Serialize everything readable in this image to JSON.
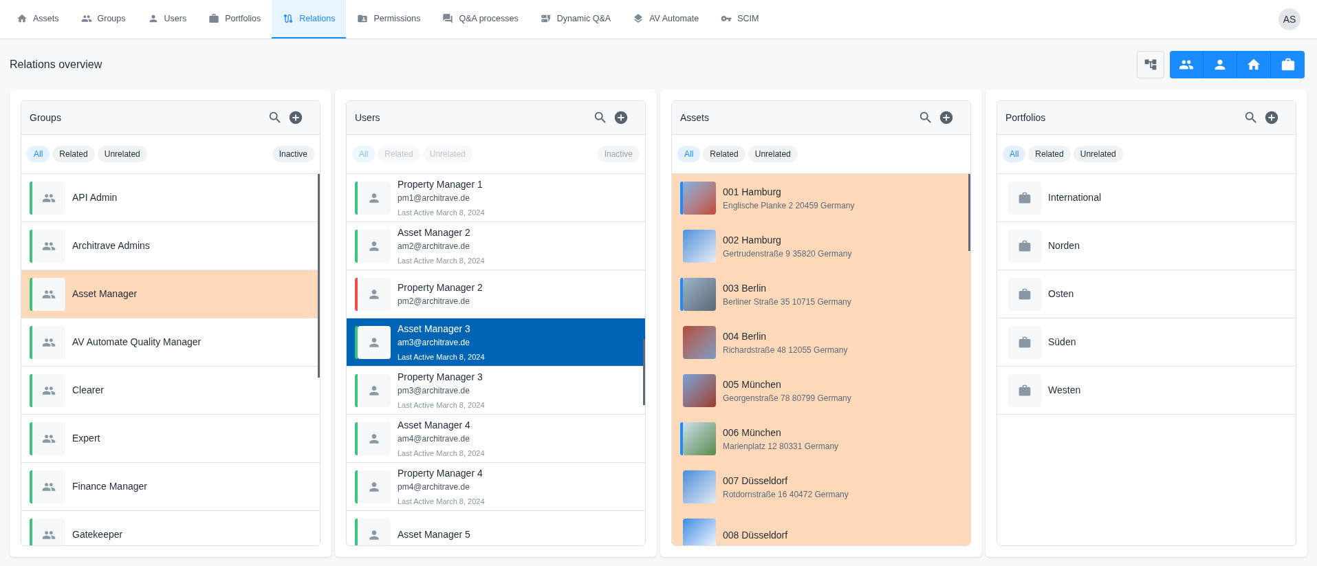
{
  "nav": {
    "tabs": [
      {
        "label": "Assets",
        "selected": false
      },
      {
        "label": "Groups",
        "selected": false
      },
      {
        "label": "Users",
        "selected": false
      },
      {
        "label": "Portfolios",
        "selected": false
      },
      {
        "label": "Relations",
        "selected": true
      },
      {
        "label": "Permissions",
        "selected": false
      },
      {
        "label": "Q&A processes",
        "selected": false
      },
      {
        "label": "Dynamic Q&A",
        "selected": false
      },
      {
        "label": "AV Automate",
        "selected": false
      },
      {
        "label": "SCIM",
        "selected": false
      }
    ],
    "avatar": "AS"
  },
  "page_title": "Relations overview",
  "columns": [
    {
      "kind": "groups",
      "title": "Groups",
      "filters_disabled": false,
      "filters": [
        {
          "label": "All",
          "selected": true
        },
        {
          "label": "Related",
          "selected": false
        },
        {
          "label": "Unrelated",
          "selected": false
        }
      ],
      "inactive": "Inactive",
      "items": [
        {
          "name": "API Admin",
          "color": "#3cc47c",
          "highlighted": false,
          "selected": false
        },
        {
          "name": "Architrave Admins",
          "color": "#3cc47c",
          "highlighted": false,
          "selected": false
        },
        {
          "name": "Asset Manager",
          "color": "#3cc47c",
          "highlighted": true,
          "selected": false
        },
        {
          "name": "AV Automate Quality Manager",
          "color": "#3cc47c",
          "highlighted": false,
          "selected": false
        },
        {
          "name": "Clearer",
          "color": "#3cc47c",
          "highlighted": false,
          "selected": false
        },
        {
          "name": "Expert",
          "color": "#3cc47c",
          "highlighted": false,
          "selected": false
        },
        {
          "name": "Finance Manager",
          "color": "#3cc47c",
          "highlighted": false,
          "selected": false
        },
        {
          "name": "Gatekeeper",
          "color": "#3cc47c",
          "highlighted": false,
          "selected": false
        }
      ]
    },
    {
      "kind": "users",
      "title": "Users",
      "filters_disabled": true,
      "filters": [
        {
          "label": "All",
          "selected": true
        },
        {
          "label": "Related",
          "selected": false
        },
        {
          "label": "Unrelated",
          "selected": false
        }
      ],
      "inactive": "Inactive",
      "items": [
        {
          "name": "Property Manager 1",
          "email": "pm1@architrave.de",
          "last_active": "Last Active March 8, 2024",
          "color": "#3cc47c",
          "selected": false
        },
        {
          "name": "Asset Manager 2",
          "email": "am2@architrave.de",
          "last_active": "Last Active March 8, 2024",
          "color": "#3cc47c",
          "selected": false
        },
        {
          "name": "Property Manager 2",
          "email": "pm2@architrave.de",
          "color": "#f04c4c",
          "selected": false
        },
        {
          "name": "Asset Manager 3",
          "email": "am3@architrave.de",
          "last_active": "Last Active March 8, 2024",
          "color": "#3cc47c",
          "selected": true
        },
        {
          "name": "Property Manager 3",
          "email": "pm3@architrave.de",
          "last_active": "Last Active March 8, 2024",
          "color": "#3cc47c",
          "selected": false
        },
        {
          "name": "Asset Manager 4",
          "email": "am4@architrave.de",
          "last_active": "Last Active March 8, 2024",
          "color": "#3cc47c",
          "selected": false
        },
        {
          "name": "Property Manager 4",
          "email": "pm4@architrave.de",
          "last_active": "Last Active March 8, 2024",
          "color": "#3cc47c",
          "selected": false
        },
        {
          "name": "Asset Manager 5",
          "color": "#3cc47c",
          "selected": false
        }
      ]
    },
    {
      "kind": "assets",
      "title": "Assets",
      "filters_disabled": false,
      "filters": [
        {
          "label": "All",
          "selected": true
        },
        {
          "label": "Related",
          "selected": false
        },
        {
          "label": "Unrelated",
          "selected": false
        }
      ],
      "items": [
        {
          "name": "001 Hamburg",
          "address": "Englische Planke 2 20459 Germany",
          "color": "#1a8cff",
          "highlighted": true,
          "selected": false
        },
        {
          "name": "002 Hamburg",
          "address": "Gertrudenstraße 9 35820 Germany",
          "highlighted": true,
          "selected": false
        },
        {
          "name": "003 Berlin",
          "address": "Berliner Straße 35 10715 Germany",
          "color": "#1a8cff",
          "highlighted": true,
          "selected": false
        },
        {
          "name": "004 Berlin",
          "address": "Richardstraße 48 12055 Germany",
          "highlighted": true,
          "selected": false
        },
        {
          "name": "005 München",
          "address": "Georgenstraße 78 80799 Germany",
          "highlighted": true,
          "selected": false
        },
        {
          "name": "006 München",
          "address": "Marienplatz 12 80331 Germany",
          "color": "#1a8cff",
          "highlighted": true,
          "selected": false
        },
        {
          "name": "007 Düsseldorf",
          "address": "Rotdornstraße 16 40472 Germany",
          "highlighted": true,
          "selected": false
        },
        {
          "name": "008 Düsseldorf",
          "highlighted": true,
          "selected": false
        }
      ]
    },
    {
      "kind": "portfolios",
      "title": "Portfolios",
      "filters_disabled": false,
      "filters": [
        {
          "label": "All",
          "selected": true
        },
        {
          "label": "Related",
          "selected": false
        },
        {
          "label": "Unrelated",
          "selected": false
        }
      ],
      "items": [
        {
          "name": "International",
          "highlighted": false,
          "selected": false
        },
        {
          "name": "Norden",
          "highlighted": false,
          "selected": false
        },
        {
          "name": "Osten",
          "highlighted": false,
          "selected": false
        },
        {
          "name": "Süden",
          "highlighted": false,
          "selected": false
        },
        {
          "name": "Westen",
          "highlighted": false,
          "selected": false
        }
      ]
    }
  ]
}
